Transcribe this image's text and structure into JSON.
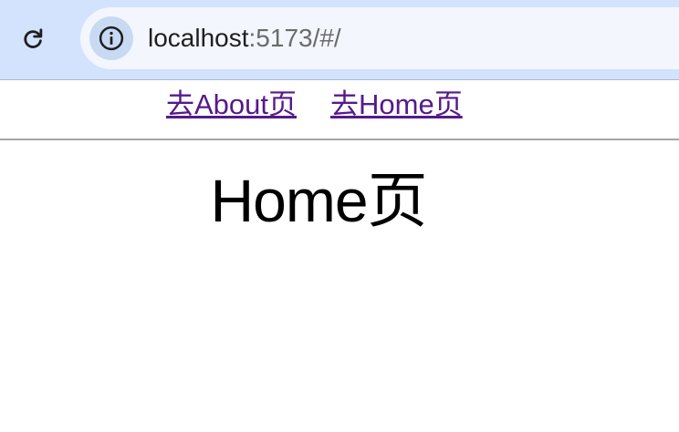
{
  "browser": {
    "url_host": "localhost",
    "url_rest": ":5173/#/",
    "reload_icon": "reload-icon",
    "site_info_icon": "info-icon"
  },
  "nav": {
    "links": [
      {
        "label": "去About页"
      },
      {
        "label": "去Home页"
      }
    ]
  },
  "main": {
    "title": "Home页"
  },
  "colors": {
    "toolbar_bg": "#d3e3fd",
    "omnibox_bg": "#f3f7fd",
    "visited_link": "#551a8b"
  }
}
